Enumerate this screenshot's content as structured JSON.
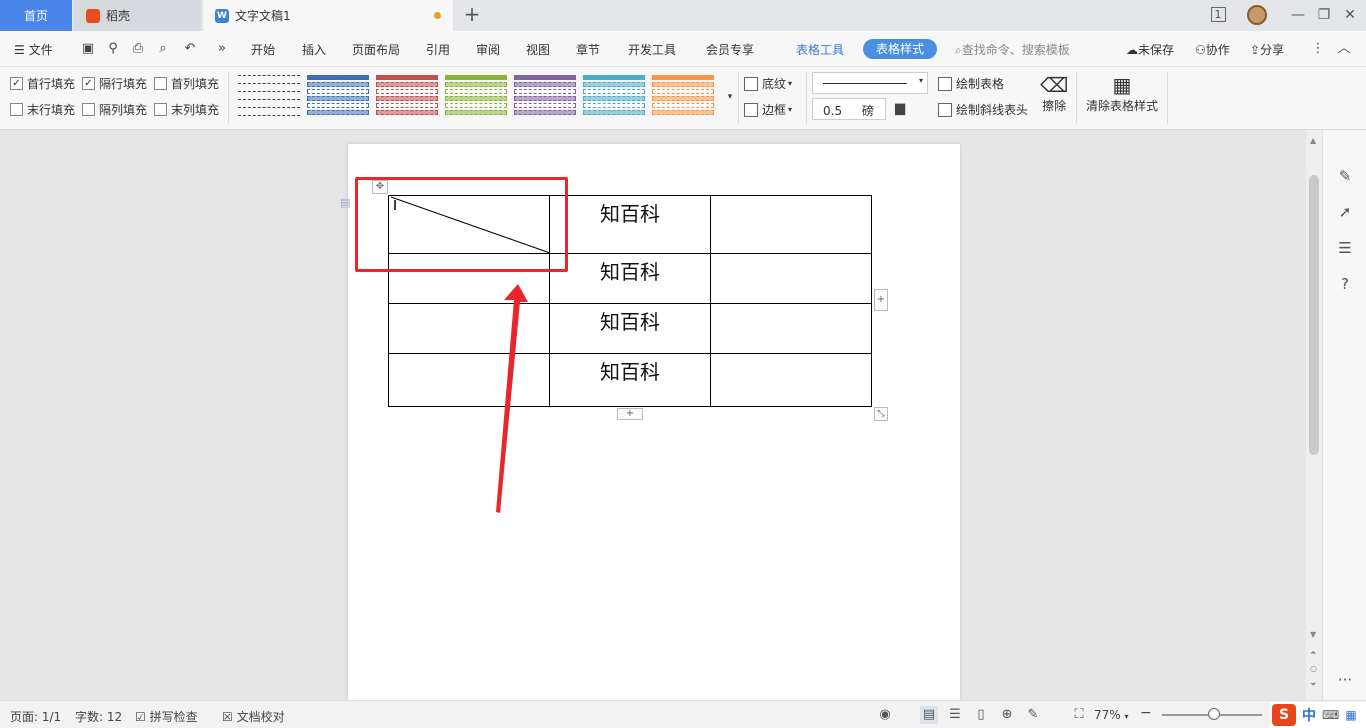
{
  "titlebar": {
    "tabs": [
      {
        "label": "首页"
      },
      {
        "label": "稻壳"
      },
      {
        "label": "文字文稿1"
      }
    ],
    "new_tab": "+",
    "page_indicator": "1",
    "window_controls": {
      "minimize": "—",
      "restore": "❐",
      "close": "✕"
    }
  },
  "menubar": {
    "file": "文件",
    "expand": "»",
    "items": [
      "开始",
      "插入",
      "页面布局",
      "引用",
      "审阅",
      "视图",
      "章节",
      "开发工具",
      "会员专享"
    ],
    "context_label": "表格工具",
    "context_active": "表格样式",
    "search": "查找命令、搜索模板",
    "unsaved": "未保存",
    "collaborate": "协作",
    "share": "分享"
  },
  "ribbon": {
    "checkboxes": [
      {
        "label": "首行填充",
        "checked": true
      },
      {
        "label": "隔行填充",
        "checked": true
      },
      {
        "label": "首列填充",
        "checked": false
      },
      {
        "label": "末行填充",
        "checked": false
      },
      {
        "label": "隔列填充",
        "checked": false
      },
      {
        "label": "末列填充",
        "checked": false
      }
    ],
    "style_colors": [
      "#808080",
      "#3f6fb5",
      "#c0504d",
      "#8bb43a",
      "#8064a2",
      "#4bacc6",
      "#f79646"
    ],
    "shading": "底纹",
    "borders": "边框",
    "line_width": "0.5",
    "line_unit": "磅",
    "draw_table": "绘制表格",
    "draw_diagonal": "绘制斜线表头",
    "erase": "擦除",
    "clear_style": "清除表格样式"
  },
  "document": {
    "table": {
      "rows": [
        [
          "",
          "知百科",
          ""
        ],
        [
          "",
          "知百科",
          ""
        ],
        [
          "",
          "知百科",
          ""
        ],
        [
          "",
          "知百科",
          ""
        ]
      ]
    },
    "highlight_color": "#e8262b"
  },
  "statusbar": {
    "page": "页面: 1/1",
    "word_count": "字数: 12",
    "spell_check": "拼写检查",
    "doc_proof": "文档校对",
    "zoom": "77%",
    "ime_logo": "S",
    "ime_lang": "中"
  }
}
